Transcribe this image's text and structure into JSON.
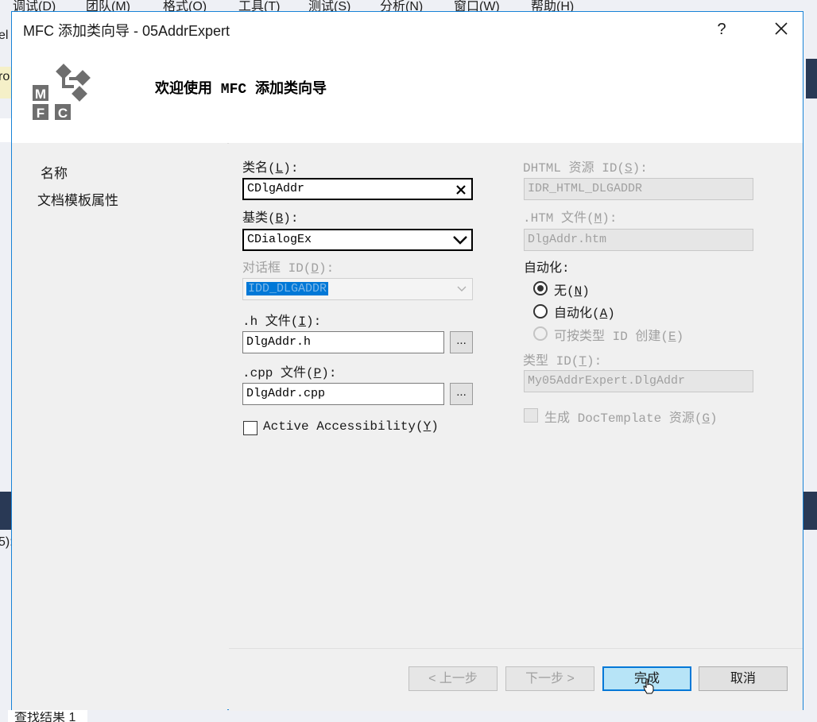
{
  "ide": {
    "menu": [
      "调试(D)",
      "团队(M)",
      "格式(O)",
      "工具(T)",
      "测试(S)",
      "分析(N)",
      "窗口(W)",
      "帮助(H)"
    ],
    "left_fragments": [
      "el",
      "ro",
      "5):"
    ],
    "bottom_tab": "查找结果 1"
  },
  "dialog": {
    "title": "MFC 添加类向导 - 05AddrExpert",
    "help_label": "?",
    "banner_title": "欢迎使用 MFC 添加类向导",
    "logo_letters": [
      "M",
      "F",
      "C"
    ]
  },
  "nav": {
    "items": [
      "名称",
      "文档模板属性"
    ]
  },
  "form": {
    "class_name": {
      "label": "类名(",
      "key": "L",
      "end": "):",
      "value": "CDlgAddr"
    },
    "base_class": {
      "label": "基类(",
      "key": "B",
      "end": "):",
      "value": "CDialogEx"
    },
    "dialog_id": {
      "label": "对话框 ID(",
      "key": "D",
      "end": "):",
      "value": "IDD_DLGADDR"
    },
    "h_file": {
      "label": ".h 文件(",
      "key": "I",
      "end": "):",
      "value": "DlgAddr.h"
    },
    "cpp_file": {
      "label": ".cpp 文件(",
      "key": "P",
      "end": "):",
      "value": "DlgAddr.cpp"
    },
    "browse_label": "...",
    "active_accessibility": {
      "label": "Active Accessibility(",
      "key": "Y",
      "end": ")"
    },
    "dhtml_id": {
      "label": "DHTML 资源 ID(",
      "key": "S",
      "end": "):",
      "value": "IDR_HTML_DLGADDR"
    },
    "htm_file": {
      "label": ".HTM 文件(",
      "key": "M",
      "end": "):",
      "value": "DlgAddr.htm"
    },
    "automation": {
      "label": "自动化:",
      "none": {
        "label": "无(",
        "key": "N",
        "end": ")"
      },
      "auto": {
        "label": "自动化(",
        "key": "A",
        "end": ")"
      },
      "creatable": {
        "label": "可按类型 ID 创建(",
        "key": "E",
        "end": ")"
      }
    },
    "type_id": {
      "label": "类型 ID(",
      "key": "T",
      "end": "):",
      "value": "My05AddrExpert.DlgAddr"
    },
    "gen_doctemplate": {
      "label": "生成 DocTemplate 资源(",
      "key": "G",
      "end": ")"
    }
  },
  "buttons": {
    "prev": "< 上一步",
    "next": "下一步 >",
    "finish": "完成",
    "cancel": "取消"
  },
  "colors": {
    "accent": "#0078d7",
    "selection": "#0078d7",
    "ide_bg": "#293955"
  }
}
